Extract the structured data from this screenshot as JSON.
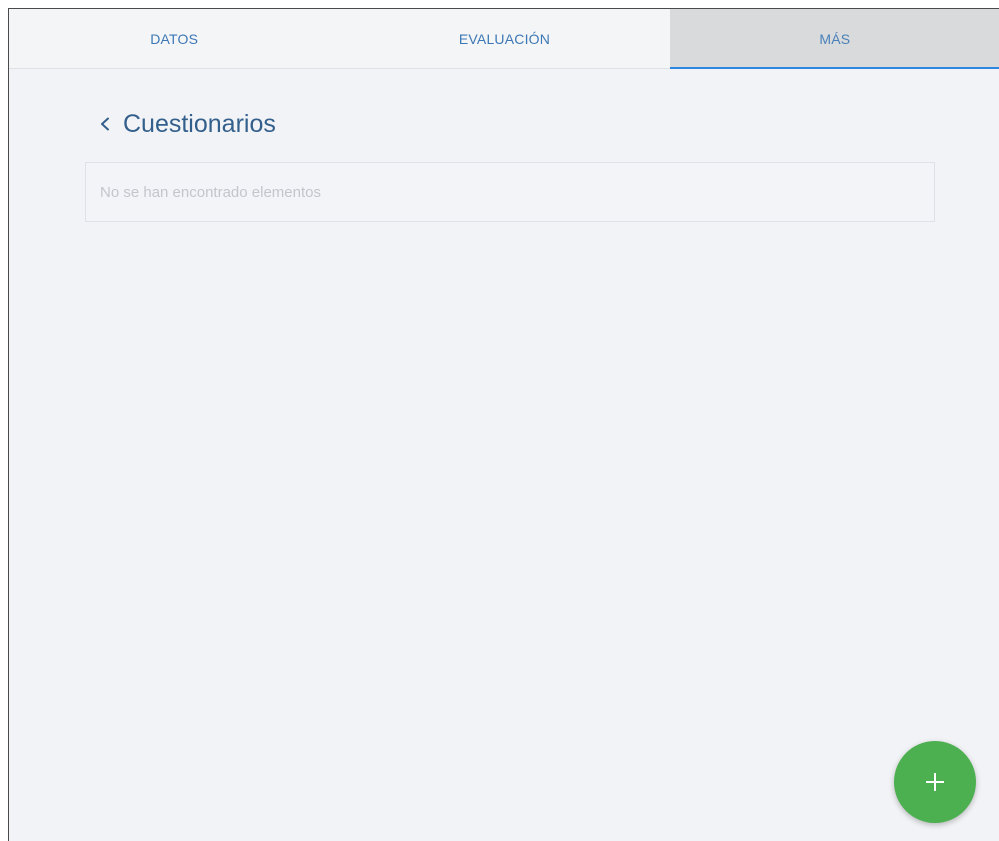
{
  "tabs": [
    {
      "label": "DATOS",
      "active": false
    },
    {
      "label": "EVALUACIÓN",
      "active": false
    },
    {
      "label": "MÁS",
      "active": true
    }
  ],
  "section": {
    "back_icon": "chevron-left-icon",
    "title": "Cuestionarios"
  },
  "list": {
    "empty_message": "No se han encontrado elementos"
  },
  "fab": {
    "icon": "plus-icon",
    "color": "#4caf50"
  },
  "colors": {
    "accent": "#2f86e0",
    "tab_text": "#3d78b5",
    "title": "#335f8c",
    "background": "#f2f3f6"
  }
}
